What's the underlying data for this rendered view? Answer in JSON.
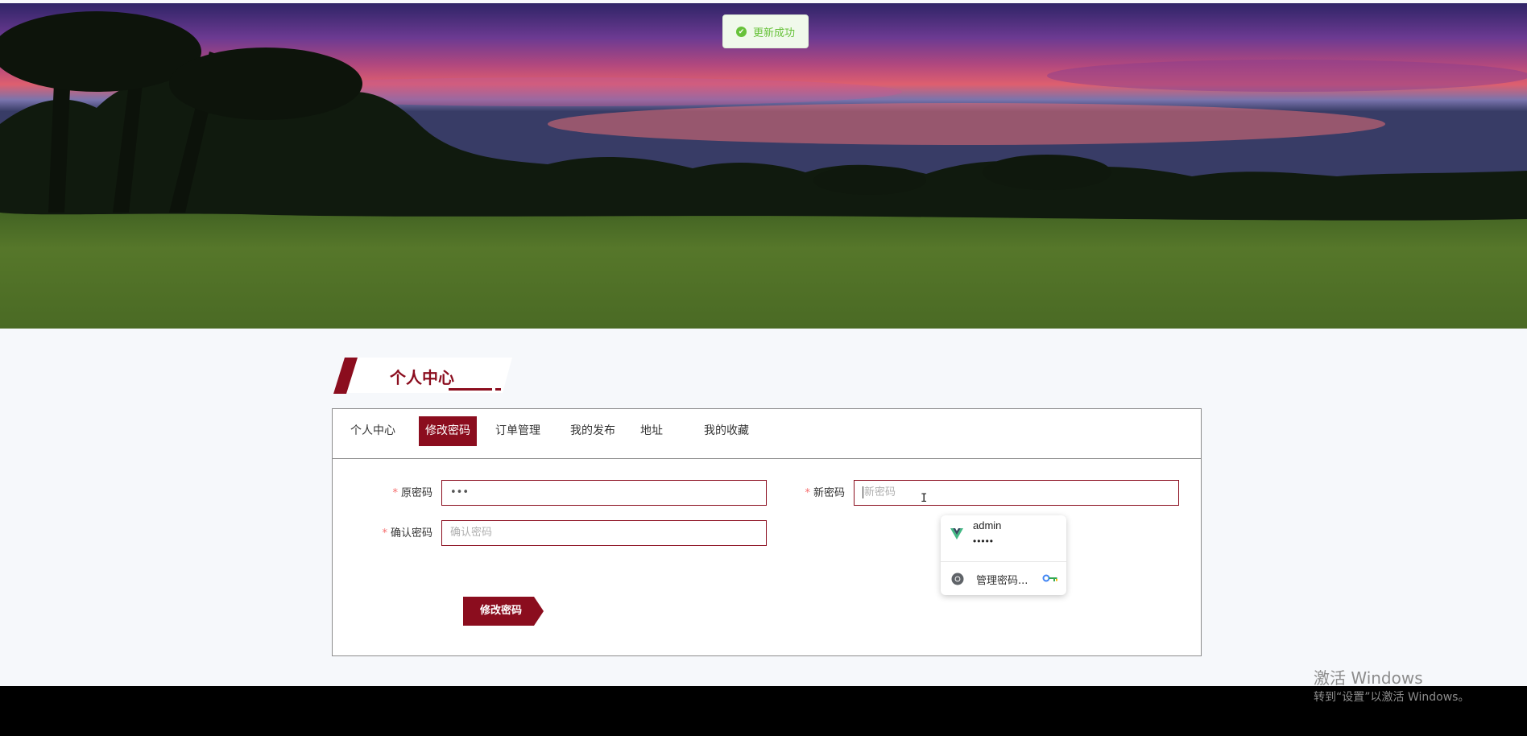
{
  "toast": {
    "message": "更新成功",
    "icon": "success-check-icon",
    "color": "#67c23a"
  },
  "section": {
    "title": "个人中心",
    "accent": "#8b0d1e"
  },
  "tabs": [
    {
      "label": "个人中心",
      "active": false
    },
    {
      "label": "修改密码",
      "active": true
    },
    {
      "label": "订单管理",
      "active": false
    },
    {
      "label": "我的发布",
      "active": false
    },
    {
      "label": "地址",
      "active": false
    },
    {
      "label": "我的收藏",
      "active": false
    }
  ],
  "form": {
    "old_password": {
      "label": "原密码",
      "value": "•••"
    },
    "new_password": {
      "label": "新密码",
      "placeholder": "新密码",
      "value": ""
    },
    "confirm_password": {
      "label": "确认密码",
      "placeholder": "确认密码",
      "value": ""
    },
    "submit_label": "修改密码"
  },
  "autofill": {
    "username": "admin",
    "password_mask": "•••••",
    "manage_label": "管理密码..."
  },
  "watermark": {
    "line1": "激活 Windows",
    "line2": "转到“设置”以激活 Windows。"
  }
}
